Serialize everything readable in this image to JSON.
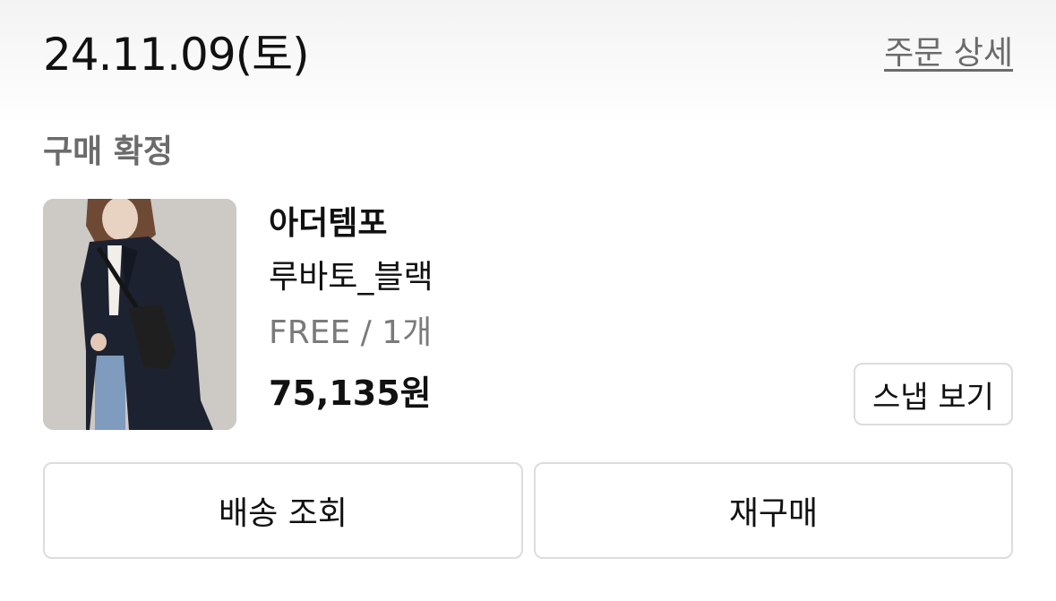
{
  "order": {
    "date": "24.11.09(토)",
    "detail_link": "주문 상세",
    "status": "구매 확정"
  },
  "item": {
    "brand": "아더템포",
    "name": "루바토_블랙",
    "option": "FREE / 1개",
    "price": "75,135원",
    "snap_button": "스냅 보기"
  },
  "actions": {
    "delivery_label": "배송 조회",
    "rebuy_label": "재구매"
  },
  "colors": {
    "text_primary": "#111111",
    "text_secondary": "#6b6b6b",
    "border": "#dcdcdc"
  }
}
